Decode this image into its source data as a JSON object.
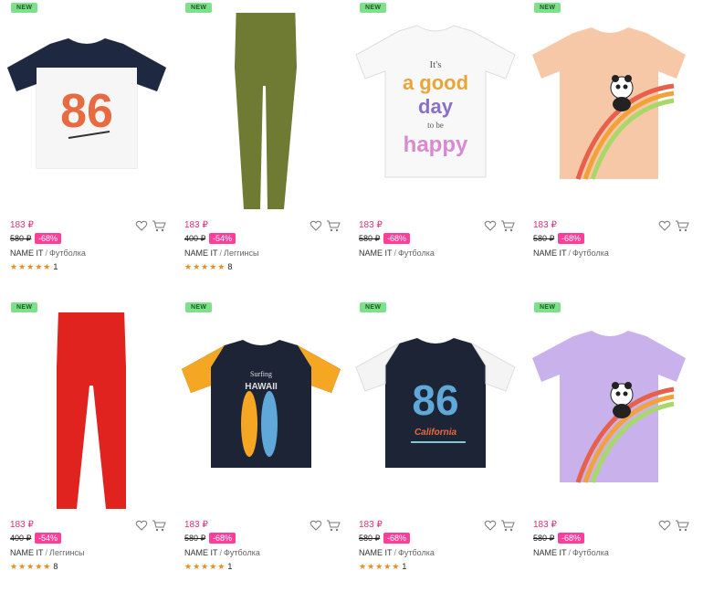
{
  "products": [
    {
      "badge": "NEW",
      "price": "183 ₽",
      "old_price": "580 ₽",
      "discount": "-68%",
      "brand": "NAME IT",
      "type": "Футболка",
      "stars": "★★★★★",
      "count": "1"
    },
    {
      "badge": "NEW",
      "price": "183 ₽",
      "old_price": "400 ₽",
      "discount": "-54%",
      "brand": "NAME IT",
      "type": "Леггинсы",
      "stars": "★★★★★",
      "count": "8"
    },
    {
      "badge": "NEW",
      "price": "183 ₽",
      "old_price": "580 ₽",
      "discount": "-68%",
      "brand": "NAME IT",
      "type": "Футболка",
      "stars": "",
      "count": ""
    },
    {
      "badge": "NEW",
      "price": "183 ₽",
      "old_price": "580 ₽",
      "discount": "-68%",
      "brand": "NAME IT",
      "type": "Футболка",
      "stars": "",
      "count": ""
    },
    {
      "badge": "NEW",
      "price": "183 ₽",
      "old_price": "400 ₽",
      "discount": "-54%",
      "brand": "NAME IT",
      "type": "Леггинсы",
      "stars": "★★★★★",
      "count": "8"
    },
    {
      "badge": "NEW",
      "price": "183 ₽",
      "old_price": "580 ₽",
      "discount": "-68%",
      "brand": "NAME IT",
      "type": "Футболка",
      "stars": "★★★★★",
      "count": "1"
    },
    {
      "badge": "NEW",
      "price": "183 ₽",
      "old_price": "580 ₽",
      "discount": "-68%",
      "brand": "NAME IT",
      "type": "Футболка",
      "stars": "★★★★★",
      "count": "1"
    },
    {
      "badge": "NEW",
      "price": "183 ₽",
      "old_price": "580 ₽",
      "discount": "-68%",
      "brand": "NAME IT",
      "type": "Футболка",
      "stars": "",
      "count": ""
    }
  ],
  "shirt_text": {
    "p1_number": "86",
    "p3_line1": "It's",
    "p3_line2": "a good",
    "p3_line3": "day",
    "p3_line4": "to be",
    "p3_line5": "happy",
    "p6_line1": "Surfing",
    "p6_line2": "HAWAII",
    "p7_number": "86",
    "p7_sub": "California"
  },
  "colors": {
    "price": "#e0307a",
    "discount_bg": "#ff3d9a",
    "badge_bg": "#7ee08a",
    "star": "#f08a1c"
  }
}
